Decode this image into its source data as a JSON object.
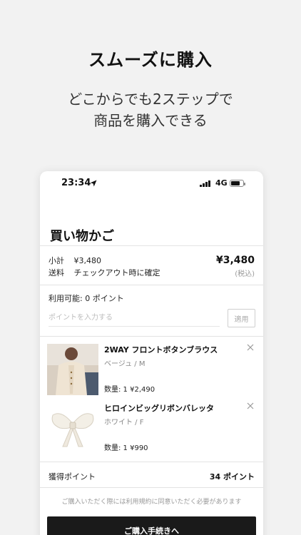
{
  "promo": {
    "headline": "スムーズに購入",
    "subline_1": "どこからでも2ステップで",
    "subline_2": "商品を購入できる"
  },
  "status_bar": {
    "time": "23:34",
    "network": "4G",
    "location_icon": "location-arrow-icon",
    "battery_level": 0.75
  },
  "cart": {
    "title": "買い物かご",
    "subtotal_label": "小計",
    "subtotal_value": "¥3,480",
    "shipping_label": "送料",
    "shipping_value": "チェックアウト時に確定",
    "total": "¥3,480",
    "tax_note": "(税込)",
    "points_available": "利用可能: 0 ポイント",
    "points_placeholder": "ポイントを入力する",
    "apply_label": "適用",
    "items": [
      {
        "name": "2WAY フロントボタンブラウス",
        "variant": "ベージュ / M",
        "qty_price": "数量: 1  ¥2,490",
        "image_icon": "blouse-product-image"
      },
      {
        "name": "ヒロインビッグリボンバレッタ",
        "variant": "ホワイト / F",
        "qty_price": "数量: 1  ¥990",
        "image_icon": "ribbon-product-image"
      }
    ],
    "earned_points_label": "獲得ポイント",
    "earned_points_value": "34 ポイント",
    "terms_notice": "ご購入いただく際には利用規約に同意いただく必要があります",
    "checkout_label": "ご購入手続きへ"
  },
  "colors": {
    "background": "#f2f2f2",
    "button": "#1a1a1a",
    "divider": "#e3e3e3"
  }
}
